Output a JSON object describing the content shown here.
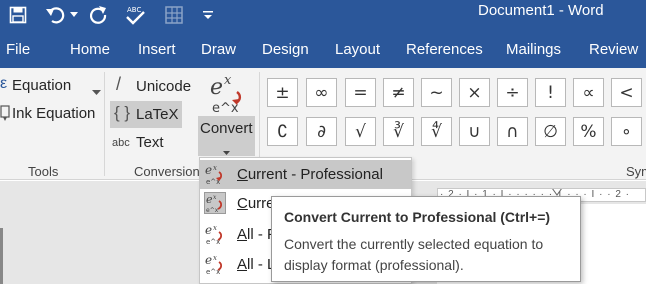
{
  "window": {
    "title": "Document1  -  Word"
  },
  "tabs": [
    "File",
    "Home",
    "Insert",
    "Draw",
    "Design",
    "Layout",
    "References",
    "Mailings",
    "Review"
  ],
  "ribbon": {
    "tools": {
      "equation_label": "Equation",
      "ink_equation_label": "Ink Equation",
      "group_label": "Tools"
    },
    "conversions": {
      "unicode_label": "Unicode",
      "latex_label": "LaTeX",
      "text_label": "Text",
      "abc_glyph": "abc",
      "convert_label": "Convert",
      "group_label": "Conversions"
    },
    "symbols": {
      "row1": [
        "±",
        "∞",
        "=",
        "≠",
        "~",
        "×",
        "÷",
        "!",
        "∝",
        "<"
      ],
      "row2": [
        "∁",
        "∂",
        "√",
        "∛",
        "∜",
        "∪",
        "∩",
        "∅",
        "%",
        "∘"
      ],
      "group_label": "Symbols"
    }
  },
  "convert_menu": {
    "items": [
      {
        "label_underlined": "C",
        "label_rest": "urrent - Professional",
        "selected": true
      },
      {
        "label_underlined": "C",
        "label_rest": "urrent - Linear",
        "selected": false
      },
      {
        "label_underlined": "A",
        "label_rest": "ll - Professional",
        "selected": false
      },
      {
        "label_underlined": "A",
        "label_rest": "ll - Linear",
        "selected": false
      }
    ]
  },
  "tooltip": {
    "title": "Convert Current to Professional (Ctrl+=)",
    "body": "Convert the currently selected equation to display format (professional)."
  },
  "ruler": {
    "marks": "· 2 · I · 1 · I · · · · · · 1 · · · I · · 2 ·"
  },
  "colors": {
    "title_bar": "#2b579a",
    "ribbon": "#f3f3f3",
    "highlight": "#cdcdcd",
    "convert_icon_red": "#c0392b"
  }
}
